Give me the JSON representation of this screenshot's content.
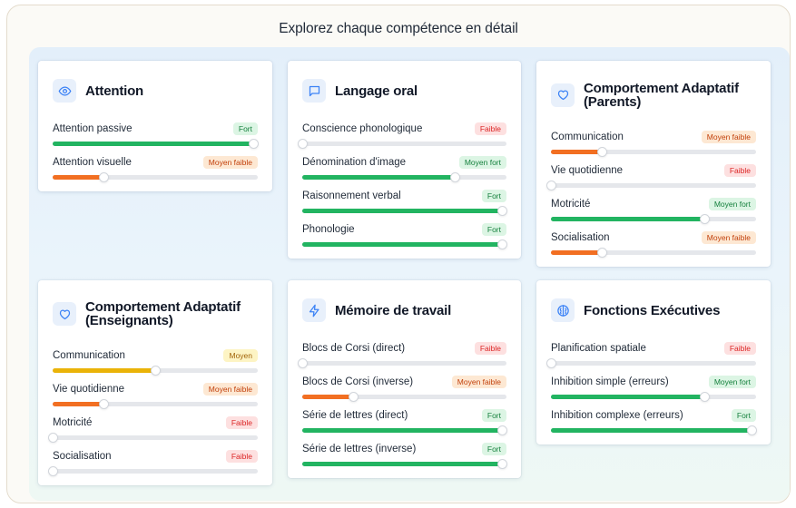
{
  "page": {
    "title": "Explorez chaque compétence en détail"
  },
  "colors": {
    "strong": "#22b461",
    "low_mid": "#f26f22",
    "mid": "#eab308",
    "track": "#e5e7eb",
    "icon": "#3b82f6"
  },
  "cards": [
    {
      "title": "Attention",
      "icon": "eye-icon",
      "rows": [
        {
          "label": "Attention passive",
          "badge": "Fort",
          "level": "fort",
          "value": 0.98
        },
        {
          "label": "Attention visuelle",
          "badge": "Moyen faible",
          "level": "moyenfaible",
          "value": 0.25
        }
      ]
    },
    {
      "title": "Langage oral",
      "icon": "speech-bubble-icon",
      "rows": [
        {
          "label": "Conscience phonologique",
          "badge": "Faible",
          "level": "faible",
          "value": 0.0
        },
        {
          "label": "Dénomination d'image",
          "badge": "Moyen fort",
          "level": "moyenfort",
          "value": 0.75
        },
        {
          "label": "Raisonnement verbal",
          "badge": "Fort",
          "level": "fort",
          "value": 0.98
        },
        {
          "label": "Phonologie",
          "badge": "Fort",
          "level": "fort",
          "value": 0.98
        }
      ]
    },
    {
      "title": "Comportement Adaptatif (Parents)",
      "icon": "heart-icon",
      "rows": [
        {
          "label": "Communication",
          "badge": "Moyen faible",
          "level": "moyenfaible",
          "value": 0.25
        },
        {
          "label": "Vie quotidienne",
          "badge": "Faible",
          "level": "faible",
          "value": 0.0
        },
        {
          "label": "Motricité",
          "badge": "Moyen fort",
          "level": "moyenfort",
          "value": 0.75
        },
        {
          "label": "Socialisation",
          "badge": "Moyen faible",
          "level": "moyenfaible",
          "value": 0.25
        }
      ]
    },
    {
      "title": "Comportement Adaptatif (Enseignants)",
      "icon": "heart-icon",
      "rows": [
        {
          "label": "Communication",
          "badge": "Moyen",
          "level": "moyen",
          "value": 0.5
        },
        {
          "label": "Vie quotidienne",
          "badge": "Moyen faible",
          "level": "moyenfaible",
          "value": 0.25
        },
        {
          "label": "Motricité",
          "badge": "Faible",
          "level": "faible",
          "value": 0.0
        },
        {
          "label": "Socialisation",
          "badge": "Faible",
          "level": "faible",
          "value": 0.0
        }
      ]
    },
    {
      "title": "Mémoire de travail",
      "icon": "lightning-icon",
      "rows": [
        {
          "label": "Blocs de Corsi (direct)",
          "badge": "Faible",
          "level": "faible",
          "value": 0.0
        },
        {
          "label": "Blocs de Corsi (inverse)",
          "badge": "Moyen faible",
          "level": "moyenfaible",
          "value": 0.25
        },
        {
          "label": "Série de lettres (direct)",
          "badge": "Fort",
          "level": "fort",
          "value": 0.98
        },
        {
          "label": "Série de lettres (inverse)",
          "badge": "Fort",
          "level": "fort",
          "value": 0.98
        }
      ]
    },
    {
      "title": "Fonctions Exécutives",
      "icon": "brain-icon",
      "rows": [
        {
          "label": "Planification spatiale",
          "badge": "Faible",
          "level": "faible",
          "value": 0.0
        },
        {
          "label": "Inhibition simple (erreurs)",
          "badge": "Moyen fort",
          "level": "moyenfort",
          "value": 0.75
        },
        {
          "label": "Inhibition complexe (erreurs)",
          "badge": "Fort",
          "level": "fort",
          "value": 0.98
        }
      ]
    }
  ]
}
